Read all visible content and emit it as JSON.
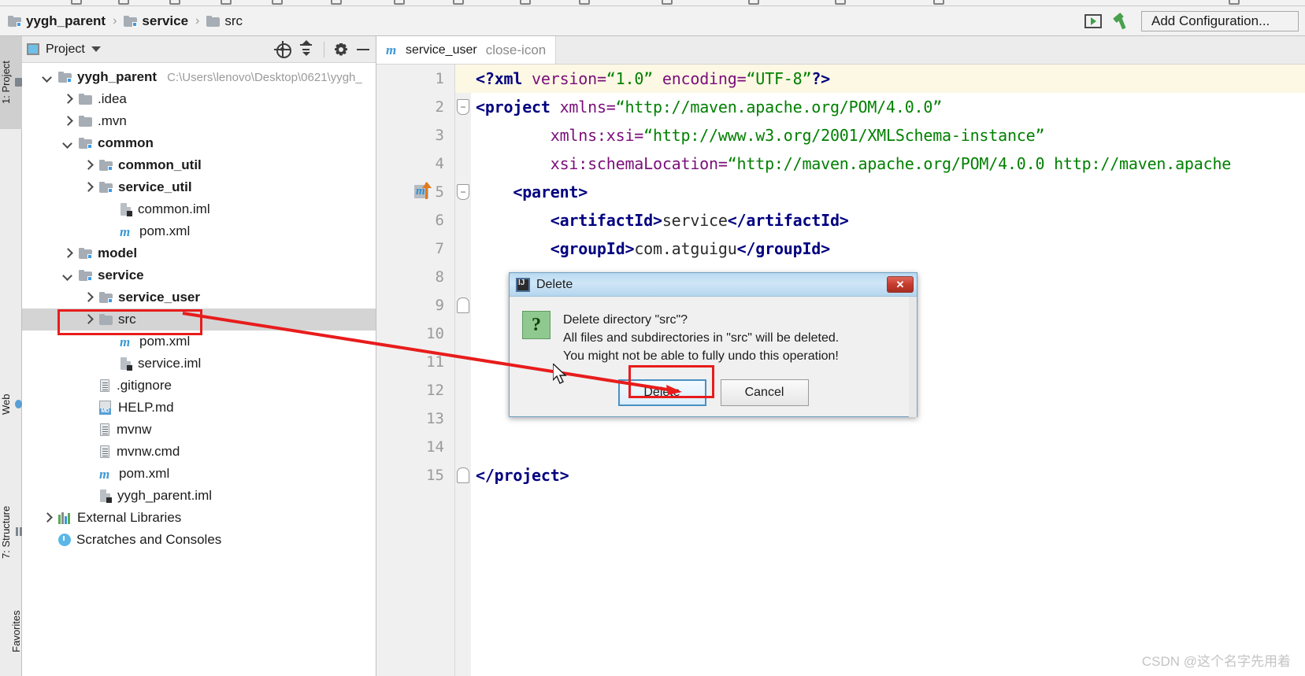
{
  "breadcrumb": {
    "items": [
      {
        "label": "yygh_parent",
        "bold": true,
        "icon": "folder-module-icon"
      },
      {
        "label": "service",
        "bold": true,
        "icon": "folder-module-icon"
      },
      {
        "label": "src",
        "bold": false,
        "icon": "folder-icon"
      }
    ],
    "separator": "›"
  },
  "toolbar": {
    "run_icon": "run-icon",
    "build_icon": "build-hammer-icon",
    "add_configuration_label": "Add Configuration..."
  },
  "tool_window_tabs": [
    {
      "label": "1: Project",
      "icon": "project-folder-icon",
      "active": true
    },
    {
      "label": "Web",
      "icon": "web-globe-icon",
      "active": false
    },
    {
      "label": "7: Structure",
      "icon": "structure-bars-icon",
      "active": false
    },
    {
      "label": "Favorites",
      "icon": "favorites-icon",
      "active": false
    }
  ],
  "project_panel": {
    "title": "Project",
    "dropdown_icon": "chevron-down-icon",
    "actions": [
      {
        "name": "locate-icon"
      },
      {
        "name": "collapse-all-icon"
      },
      {
        "name": "gear-icon"
      },
      {
        "name": "minimize-icon"
      }
    ],
    "tree": [
      {
        "label": "yygh_parent",
        "path": "C:\\Users\\lenovo\\Desktop\\0621\\yygh_",
        "depth": 0,
        "arrow": "down",
        "icon": "folder-module-icon",
        "bold": true
      },
      {
        "label": ".idea",
        "depth": 1,
        "arrow": "right",
        "icon": "folder-icon",
        "bold": false
      },
      {
        "label": ".mvn",
        "depth": 1,
        "arrow": "right",
        "icon": "folder-icon",
        "bold": false
      },
      {
        "label": "common",
        "depth": 1,
        "arrow": "down",
        "icon": "folder-module-icon",
        "bold": true
      },
      {
        "label": "common_util",
        "depth": 2,
        "arrow": "right",
        "icon": "folder-module-icon",
        "bold": true
      },
      {
        "label": "service_util",
        "depth": 2,
        "arrow": "right",
        "icon": "folder-module-icon",
        "bold": true
      },
      {
        "label": "common.iml",
        "depth": 3,
        "arrow": "none",
        "icon": "iml-file-icon",
        "bold": false
      },
      {
        "label": "pom.xml",
        "depth": 3,
        "arrow": "none",
        "icon": "maven-file-icon",
        "bold": false
      },
      {
        "label": "model",
        "depth": 1,
        "arrow": "right",
        "icon": "folder-module-icon",
        "bold": true
      },
      {
        "label": "service",
        "depth": 1,
        "arrow": "down",
        "icon": "folder-module-icon",
        "bold": true
      },
      {
        "label": "service_user",
        "depth": 2,
        "arrow": "right",
        "icon": "folder-module-icon",
        "bold": true
      },
      {
        "label": "src",
        "depth": 2,
        "arrow": "right",
        "icon": "folder-icon",
        "bold": false,
        "selected": true
      },
      {
        "label": "pom.xml",
        "depth": 3,
        "arrow": "none",
        "icon": "maven-file-icon",
        "bold": false
      },
      {
        "label": "service.iml",
        "depth": 3,
        "arrow": "none",
        "icon": "iml-file-icon",
        "bold": false
      },
      {
        "label": ".gitignore",
        "depth": 2,
        "arrow": "none",
        "icon": "text-file-icon",
        "bold": false
      },
      {
        "label": "HELP.md",
        "depth": 2,
        "arrow": "none",
        "icon": "markdown-file-icon",
        "bold": false
      },
      {
        "label": "mvnw",
        "depth": 2,
        "arrow": "none",
        "icon": "text-file-icon",
        "bold": false
      },
      {
        "label": "mvnw.cmd",
        "depth": 2,
        "arrow": "none",
        "icon": "text-file-icon",
        "bold": false
      },
      {
        "label": "pom.xml",
        "depth": 2,
        "arrow": "none",
        "icon": "maven-file-icon",
        "bold": false
      },
      {
        "label": "yygh_parent.iml",
        "depth": 2,
        "arrow": "none",
        "icon": "iml-file-icon",
        "bold": false
      },
      {
        "label": "External Libraries",
        "depth": 0,
        "arrow": "right",
        "icon": "libraries-icon",
        "bold": false
      },
      {
        "label": "Scratches and Consoles",
        "depth": 0,
        "arrow": "none",
        "icon": "scratches-icon",
        "bold": false
      }
    ]
  },
  "editor": {
    "tabs": [
      {
        "label": "service_user",
        "icon": "maven-file-icon",
        "close_icon": "close-icon",
        "active": true
      }
    ],
    "lines": [
      {
        "num": "1",
        "current": true,
        "fold": "none",
        "segments": [
          {
            "t": "<?",
            "c": "pi"
          },
          {
            "t": "xml",
            "c": "pi"
          },
          {
            "t": " version=",
            "c": "attr"
          },
          {
            "t": "“1.0”",
            "c": "str"
          },
          {
            "t": " encoding=",
            "c": "attr"
          },
          {
            "t": "“UTF-8”",
            "c": "str"
          },
          {
            "t": "?>",
            "c": "pi"
          }
        ]
      },
      {
        "num": "2",
        "current": false,
        "fold": "open",
        "segments": [
          {
            "t": "<project",
            "c": "tag"
          },
          {
            "t": " xmlns=",
            "c": "attr"
          },
          {
            "t": "“http://maven.apache.org/POM/4.0.0”",
            "c": "str"
          }
        ]
      },
      {
        "num": "3",
        "current": false,
        "fold": "none",
        "segments": [
          {
            "t": "        xmlns:xsi=",
            "c": "attr"
          },
          {
            "t": "“http://www.w3.org/2001/XMLSchema-instance”",
            "c": "str"
          }
        ]
      },
      {
        "num": "4",
        "current": false,
        "fold": "none",
        "segments": [
          {
            "t": "        xsi:schemaLocation=",
            "c": "attr"
          },
          {
            "t": "“http://maven.apache.org/POM/4.0.0 http://maven.apache",
            "c": "str"
          }
        ]
      },
      {
        "num": "5",
        "current": false,
        "fold": "open",
        "badge": "maven-update-icon",
        "segments": [
          {
            "t": "    <parent>",
            "c": "tag"
          }
        ]
      },
      {
        "num": "6",
        "current": false,
        "fold": "none",
        "segments": [
          {
            "t": "        <artifactId>",
            "c": "tag"
          },
          {
            "t": "service",
            "c": "txt"
          },
          {
            "t": "</artifactId>",
            "c": "tag"
          }
        ]
      },
      {
        "num": "7",
        "current": false,
        "fold": "none",
        "segments": [
          {
            "t": "        <groupId>",
            "c": "tag"
          },
          {
            "t": "com.atguigu",
            "c": "txt"
          },
          {
            "t": "</groupId>",
            "c": "tag"
          }
        ]
      },
      {
        "num": "8",
        "current": false,
        "fold": "none",
        "segments": []
      },
      {
        "num": "9",
        "current": false,
        "fold": "close",
        "segments": []
      },
      {
        "num": "10",
        "current": false,
        "fold": "none",
        "segments": []
      },
      {
        "num": "11",
        "current": false,
        "fold": "none",
        "segments": []
      },
      {
        "num": "12",
        "current": false,
        "fold": "none",
        "segments": []
      },
      {
        "num": "13",
        "current": false,
        "fold": "none",
        "segments": []
      },
      {
        "num": "14",
        "current": false,
        "fold": "none",
        "segments": []
      },
      {
        "num": "15",
        "current": false,
        "fold": "close",
        "segments": [
          {
            "t": "</project>",
            "c": "tag"
          }
        ]
      }
    ]
  },
  "dialog": {
    "title": "Delete",
    "title_icon": "intellij-idea-icon",
    "close_label": "✕",
    "icon": "question-icon",
    "icon_glyph": "?",
    "message_lines": [
      "Delete directory \"src\"?",
      "All files and subdirectories in \"src\" will be deleted.",
      "You might not be able to fully undo this operation!"
    ],
    "buttons": [
      {
        "label": "Delete",
        "default": true,
        "highlighted": true
      },
      {
        "label": "Cancel",
        "default": false,
        "highlighted": false
      }
    ]
  },
  "annotations": {
    "color": "#e81c1c",
    "src_highlight": true,
    "arrow_to_delete_button": true
  },
  "watermark": "CSDN @这个名字先用着"
}
